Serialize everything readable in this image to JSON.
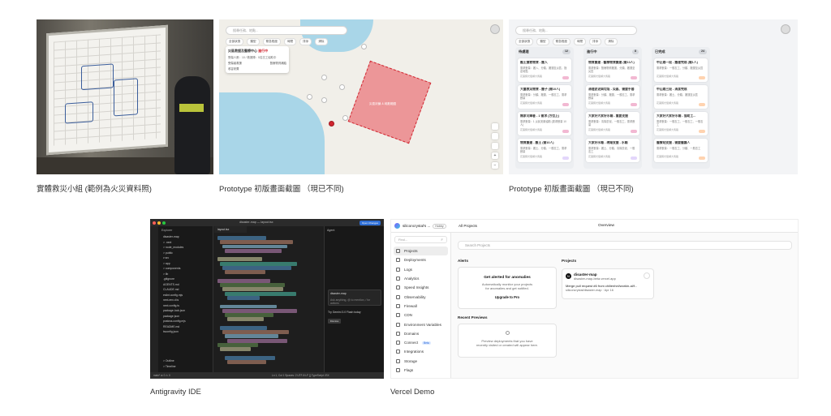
{
  "captions": {
    "photo": "實體救災小組 (範例為火災資料照)",
    "map_proto": "Prototype 初版畫面截圖 （現已不同)",
    "kanban_proto": "Prototype 初版畫面截圖 （現已不同)",
    "ide": "Antigravity  IDE",
    "vercel": "Vercel Demo"
  },
  "map_proto": {
    "search_placeholder": "搜尋任務、地點...",
    "filters": [
      "全部狀態",
      "類型",
      "緊急程度",
      "時間",
      "排序",
      "清除"
    ],
    "card": {
      "title": "災區救援及醫療中心",
      "status": "進行中",
      "subtitle": "受傷人數：10 / 救援隊：5名志工協助中",
      "item_a": "受傷者救援",
      "item_b": "醫療物資補給",
      "item_c": "收容安置"
    },
    "zone_label": "災區封鎖 & 疏散範圍",
    "controls": [
      "+",
      "−"
    ]
  },
  "kanban": {
    "search_placeholder": "搜尋任務、地點...",
    "filters": [
      "全部狀態",
      "類型",
      "緊急程度",
      "時間",
      "排序",
      "清除"
    ],
    "columns": [
      {
        "title": "待處理",
        "count": "12",
        "cards": [
          {
            "title": "壓土搶救物資 - 搬入",
            "desc": "需求數量：搬入、分類、搬運至災區、指定地點",
            "foot": "花蓮縣光復鄉大馬路",
            "tag": "#f2b8d2"
          },
          {
            "title": "大量救災物資 - 搬子 (需10人)",
            "desc": "需求數量：分類、搬運、一般志工、需求數量",
            "foot": "花蓮縣光復鄉大馬路",
            "tag": "#f2b8d2"
          },
          {
            "title": "無家可歸者 - 1 需求 (方位上)",
            "desc": "需求數量：1 災民安置協助 (需求數量 10 人)",
            "foot": "花蓮縣光復鄉大馬路",
            "tag": "#f2b8d2"
          },
          {
            "title": "物資搬運 - 搬土 (需10人)",
            "desc": "需求數量：搬土、分類、一般志工、需求數量",
            "foot": "花蓮縣光復鄉大馬路",
            "tag": "#e3d6fb"
          }
        ]
      },
      {
        "title": "進行中",
        "count": "8",
        "cards": [
          {
            "title": "物資搬運 - 醫療物資搬運 (需10人)",
            "desc": "需求數量：醫療物資搬運、分類、搬運至災區",
            "foot": "花蓮縣光復鄉大馬路",
            "tag": "#f2b8d2"
          },
          {
            "title": "清理淤泥與垃圾 - 災區、需要手套",
            "desc": "需求數量：分類、搬運、一般志工、需求數量",
            "foot": "花蓮縣光復鄉大馬路",
            "tag": "#f2b8d2"
          },
          {
            "title": "大家好大家好水箱 - 重要支援",
            "desc": "需求數量：清除淤泥、一般志工、需求數量",
            "foot": "花蓮縣光復鄉大馬路",
            "tag": "#f2b8d2"
          },
          {
            "title": "大家好水箱 - 現場支援 - 水箱",
            "desc": "需求數量：搬土、分類、清除淤泥、一般志工",
            "foot": "花蓮縣光復鄉大馬路",
            "tag": "#e3d6fb"
          }
        ]
      },
      {
        "title": "已完成",
        "count": "24",
        "cards": [
          {
            "title": "中正路一段 - 搬運完成 (需1人)",
            "desc": "需求數量：一般志工、分類、搬運至災區",
            "foot": "花蓮縣光復鄉大馬路",
            "tag": "#ffd3b0"
          },
          {
            "title": "中山路三段 - 清潔完成",
            "desc": "需求數量：搬土、分類、搬運至災區",
            "foot": "花蓮縣光復鄉大馬路",
            "tag": "#ffd3b0"
          },
          {
            "title": "大家好大家好水箱 - 協助工...",
            "desc": "需求數量：一般志工、一般志工、一般志工",
            "foot": "花蓮縣光復鄉大馬路",
            "tag": "#ffd3b0"
          },
          {
            "title": "醫療站支援 - 需要醫護人",
            "desc": "需求數量：一般志工、分類、一般志工",
            "foot": "花蓮縣光復鄉大馬路",
            "tag": "#ffd3b0"
          }
        ]
      }
    ]
  },
  "ide": {
    "window_title": "disaster-map — layout.tsx",
    "run_label": "Open Changes",
    "explorer_label": "Explorer",
    "tab_label": "layout.tsx",
    "agent_label": "Agent",
    "tree": [
      "disaster-map",
      "> .next",
      "> node_modules",
      "> public",
      "v src",
      "  > app",
      "  > components",
      "  > lib",
      ".gitignore",
      "AGENTS.md",
      "CLAUDE.md",
      "eslint.config.mjs",
      "next-env.d.ts",
      "next.config.ts",
      "package-lock.json",
      "package.json",
      "postcss.config.mjs",
      "README.md",
      "tsconfig.json"
    ],
    "outline": [
      "> Outline",
      "> Timeline"
    ],
    "agent_box_title": "disaster-map",
    "agent_box_sub": "Ask anything, @ to mention, / for actions",
    "agent_msg": "Try Gemini 3.0 Flash today",
    "agent_btn": "Dismiss",
    "status_left": "main*  ⊗ 0 ⚠ 0",
    "status_right": "Ln 1, Col 1   Spaces: 2   UTF-8   LF   {} TypeScript JSX"
  },
  "vercel": {
    "team": "siliconcrystal's ...",
    "team_badge": "Hobby",
    "all_projects": "All Projects",
    "overview": "Overview",
    "find_placeholder": "Find...",
    "find_key": "F",
    "search_placeholder": "Search Projects",
    "nav": [
      "Projects",
      "Deployments",
      "Logs",
      "Analytics",
      "Speed Insights",
      "Observability",
      "Firewall",
      "CDN",
      "Environment Variables",
      "Domains",
      "Connect",
      "Integrations",
      "Storage",
      "Flags"
    ],
    "connect_badge": "Beta",
    "alerts_title": "Alerts",
    "alerts_heading": "Get alerted for anomalies",
    "alerts_desc_1": "Automatically monitor your projects",
    "alerts_desc_2": "for anomalies and get notified.",
    "alerts_btn": "Upgrade to Pro",
    "previews_title": "Recent Previews",
    "previews_desc_1": "Preview deployments that you have",
    "previews_desc_2": "recently visited or created will appear here.",
    "projects_title": "Projects",
    "project_name": "disaster-map",
    "project_url": "disaster-map-beta.vercel.app",
    "project_commit": "Merge pull request #6 from chilienhel/workin-al/f...",
    "project_repo": "siliconcrystal/disaster-map · Apr 16"
  }
}
